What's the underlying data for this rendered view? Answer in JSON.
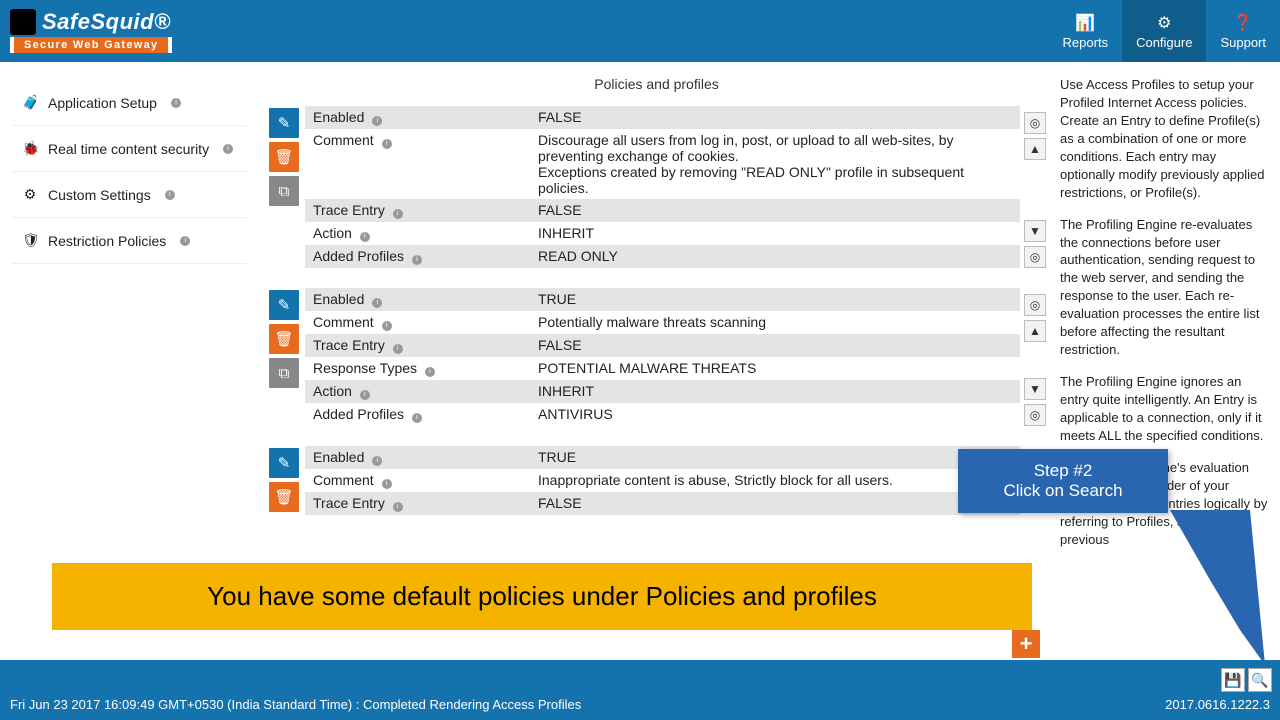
{
  "brand": {
    "name": "SafeSquid®",
    "tagline": "Secure Web Gateway"
  },
  "nav": {
    "reports": "Reports",
    "configure": "Configure",
    "support": "Support"
  },
  "sidebar": {
    "items": [
      {
        "icon": "briefcase",
        "label": "Application Setup"
      },
      {
        "icon": "bug",
        "label": "Real time content security"
      },
      {
        "icon": "sliders",
        "label": "Custom Settings"
      },
      {
        "icon": "shield",
        "label": "Restriction Policies"
      }
    ]
  },
  "page": {
    "title": "Policies and profiles"
  },
  "entries": [
    {
      "rows": [
        {
          "label": "Enabled",
          "value": "FALSE"
        },
        {
          "label": "Comment",
          "value": "Discourage all users from log in, post, or upload to all web-sites, by preventing exchange of cookies.\nExceptions created by removing \"READ ONLY\" profile in subsequent policies."
        },
        {
          "label": "Trace Entry",
          "value": "FALSE"
        },
        {
          "label": "Action",
          "value": "INHERIT"
        },
        {
          "label": "Added Profiles",
          "value": "READ ONLY"
        }
      ]
    },
    {
      "rows": [
        {
          "label": "Enabled",
          "value": "TRUE"
        },
        {
          "label": "Comment",
          "value": "Potentially malware threats scanning"
        },
        {
          "label": "Trace Entry",
          "value": "FALSE"
        },
        {
          "label": "Response Types",
          "value": "POTENTIAL MALWARE THREATS"
        },
        {
          "label": "Action",
          "value": "INHERIT"
        },
        {
          "label": "Added Profiles",
          "value": "ANTIVIRUS"
        }
      ]
    },
    {
      "rows": [
        {
          "label": "Enabled",
          "value": "TRUE"
        },
        {
          "label": "Comment",
          "value": "Inappropriate content is abuse, Strictly block for all users."
        },
        {
          "label": "Trace Entry",
          "value": "FALSE"
        }
      ]
    }
  ],
  "right_panel": {
    "p1": "Use Access Profiles to setup your Profiled Internet Access policies. Create an Entry to define Profile(s) as a combination of one or more conditions. Each entry may optionally modify previously applied restrictions, or Profile(s).",
    "p2": "The Profiling Engine re-evaluates the connections before user authentication, sending request to the web server, and sending the response to the user. Each re-evaluation processes the entire list before affecting the resultant restriction.",
    "p3": "The Profiling Engine ignores an entry quite intelligently. An Entry is applicable to a connection, only if it meets ALL the specified conditions.",
    "p4": "The Profiling Engine's evaluation logic follows the order of your entries. Inter-link Entries logically by referring to Profiles, applied in a previous"
  },
  "banner": "You have some default policies under Policies and profiles",
  "callout": {
    "line1": "Step #2",
    "line2": "Click on Search"
  },
  "footer": {
    "status": "Fri Jun 23 2017 16:09:49 GMT+0530 (India Standard Time) : Completed Rendering Access Profiles",
    "version": "2017.0616.1222.3"
  }
}
